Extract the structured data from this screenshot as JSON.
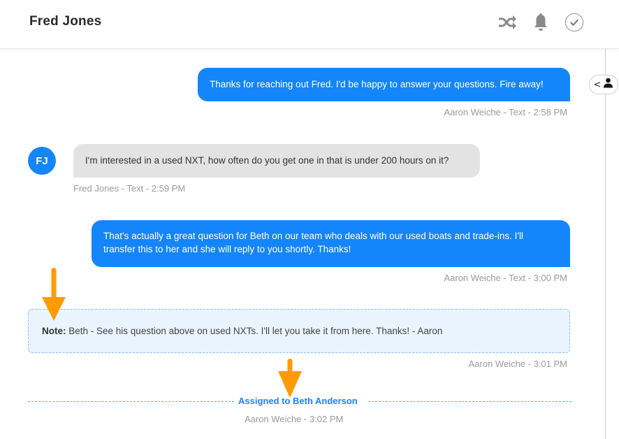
{
  "header": {
    "title": "Fred Jones",
    "icons": [
      "shuffle-icon",
      "bell-icon",
      "check-circle-icon"
    ]
  },
  "side_toggle": {
    "icons": [
      "chevron-left-icon",
      "person-icon"
    ]
  },
  "messages": [
    {
      "direction": "outgoing",
      "text": "Thanks for reaching out Fred. I'd be happy to answer your questions. Fire away!",
      "meta": "Aaron Weiche - Text - 2:58 PM"
    },
    {
      "direction": "incoming",
      "avatar_initials": "FJ",
      "text": "I'm interested in a used NXT, how often do you get one in that is under 200 hours on it?",
      "meta": "Fred Jones - Text - 2:59 PM"
    },
    {
      "direction": "outgoing",
      "text_line1": "That's actually a great question for Beth on our team who deals with our used boats and trade-ins. I'll",
      "text_line2": "transfer this to her and she will reply to you shortly. Thanks!",
      "meta": "Aaron Weiche - Text - 3:00 PM"
    }
  ],
  "note": {
    "label": "Note:",
    "text": " Beth - See his question above on used NXTs. I'll let you take it from here.  Thanks! - Aaron",
    "meta": "Aaron Weiche - 3:01 PM"
  },
  "assignment": {
    "text": "Assigned to Beth Anderson",
    "meta": "Aaron Weiche - 3:02 PM"
  },
  "colors": {
    "accent": "#1485fb",
    "incoming_bubble": "#e3e3e3",
    "note_bg": "#eaf4fe",
    "annotation_arrow": "#ff9b00"
  }
}
